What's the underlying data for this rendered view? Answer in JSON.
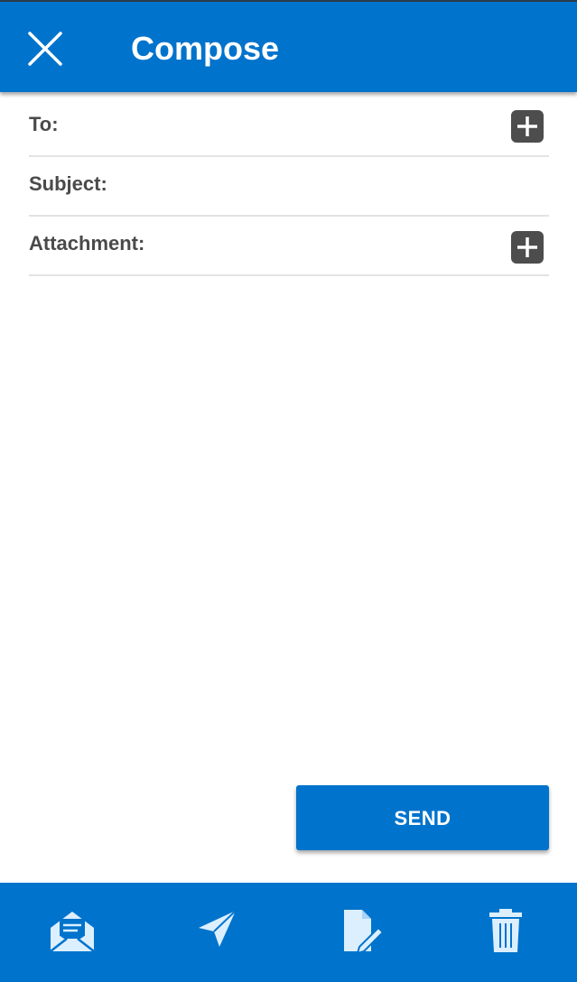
{
  "header": {
    "title": "Compose",
    "close_icon": "close-icon",
    "background_color": "#0073cc"
  },
  "form": {
    "to": {
      "label": "To:",
      "value": "",
      "add_icon": "plus-icon"
    },
    "subject": {
      "label": "Subject:",
      "value": ""
    },
    "attachment": {
      "label": "Attachment:",
      "value": "",
      "add_icon": "plus-icon"
    },
    "body": {
      "value": ""
    }
  },
  "send_button": {
    "label": "SEND",
    "color": "#0073cc"
  },
  "bottom_nav": {
    "items": [
      {
        "icon": "open-envelope-icon"
      },
      {
        "icon": "paper-plane-icon"
      },
      {
        "icon": "document-edit-icon"
      },
      {
        "icon": "trash-icon"
      }
    ],
    "background_color": "#0073cc",
    "icon_color": "#dcefff"
  }
}
